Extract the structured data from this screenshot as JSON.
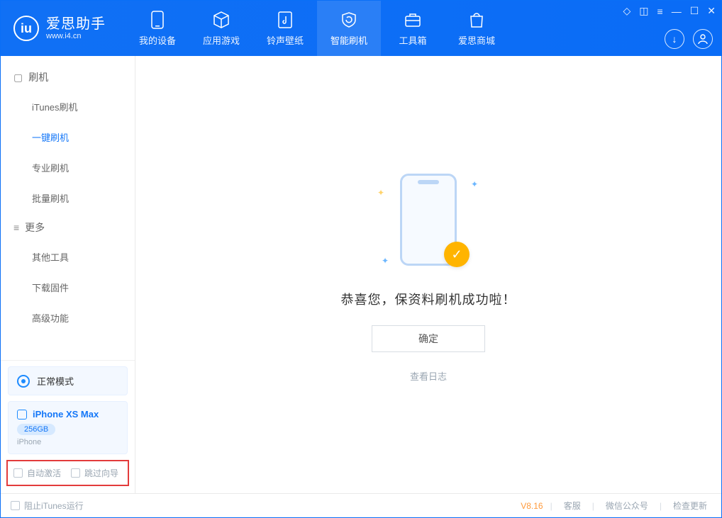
{
  "app": {
    "name": "爱思助手",
    "site": "www.i4.cn"
  },
  "nav": {
    "items": [
      {
        "label": "我的设备"
      },
      {
        "label": "应用游戏"
      },
      {
        "label": "铃声壁纸"
      },
      {
        "label": "智能刷机"
      },
      {
        "label": "工具箱"
      },
      {
        "label": "爱思商城"
      }
    ],
    "active_index": 3
  },
  "sidebar": {
    "groups": [
      {
        "title": "刷机",
        "items": [
          "iTunes刷机",
          "一键刷机",
          "专业刷机",
          "批量刷机"
        ],
        "active_index": 1
      },
      {
        "title": "更多",
        "items": [
          "其他工具",
          "下载固件",
          "高级功能"
        ],
        "active_index": -1
      }
    ]
  },
  "mode": {
    "label": "正常模式"
  },
  "device": {
    "name": "iPhone XS Max",
    "capacity": "256GB",
    "type": "iPhone"
  },
  "options": {
    "auto_activate": "自动激活",
    "skip_guide": "跳过向导"
  },
  "main": {
    "success_msg": "恭喜您，保资料刷机成功啦！",
    "ok": "确定",
    "view_log": "查看日志"
  },
  "status": {
    "block_itunes": "阻止iTunes运行",
    "version": "V8.16",
    "links": [
      "客服",
      "微信公众号",
      "检查更新"
    ]
  }
}
